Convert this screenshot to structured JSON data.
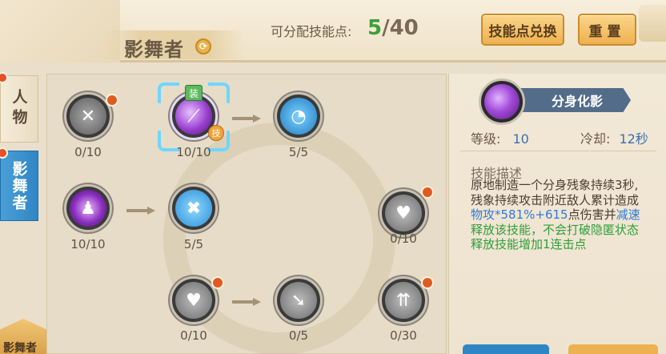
{
  "header": {
    "character_name": "影舞者",
    "points_label": "可分配技能点:",
    "points_current": "5",
    "points_sep": "/",
    "points_max": "40",
    "exchange_button": "技能点兑换",
    "reset_button": "重置"
  },
  "side_tabs": {
    "person": "人物",
    "class": "影舞者",
    "bottom": "影舞者"
  },
  "skills": [
    {
      "icon": "shield-cross-icon",
      "level": "0/10",
      "color": "#7d7d7d"
    },
    {
      "icon": "purple-slash-icon",
      "level": "10/10",
      "color": "#9a3fd0"
    },
    {
      "icon": "blue-swirl-icon",
      "level": "5/5",
      "color": "#2a8fd0"
    },
    {
      "icon": "purple-silhouette-icon",
      "level": "10/10",
      "color": "#8a2fc0"
    },
    {
      "icon": "blue-cross-blades-icon",
      "level": "5/5",
      "color": "#2d8fd6"
    },
    {
      "icon": "heart-plus-icon",
      "level": "0/10",
      "color": "#7a7a7a"
    },
    {
      "icon": "heart-face-icon",
      "level": "0/10",
      "color": "#7a7a7a"
    },
    {
      "icon": "arrow-strike-icon",
      "level": "0/5",
      "color": "#7a7a7a"
    },
    {
      "icon": "triple-arrow-up-icon",
      "level": "0/30",
      "color": "#7a7a7a"
    }
  ],
  "badges": {
    "equipped": "装",
    "skill": "技"
  },
  "detail": {
    "skill_name": "分身化影",
    "level_label": "等级:",
    "level_value": "10",
    "cooldown_label": "冷却:",
    "cooldown_value": "12秒",
    "desc_title": "技能描述",
    "desc_line1": "原地制造一个分身残象持续3秒,",
    "desc_line2": "残象持续攻击附近敌人累计造成",
    "desc_blue": "物攻*581%+615",
    "desc_mid": "点伤害并",
    "desc_blue2": "减速",
    "desc_green1": "释放该技能，不会打破隐匿状态",
    "desc_green2": "释放技能增加1连击点"
  },
  "colors": {
    "accent": "#3f9e3c",
    "button": "#eeb14f",
    "active_tab": "#2f86c4"
  }
}
